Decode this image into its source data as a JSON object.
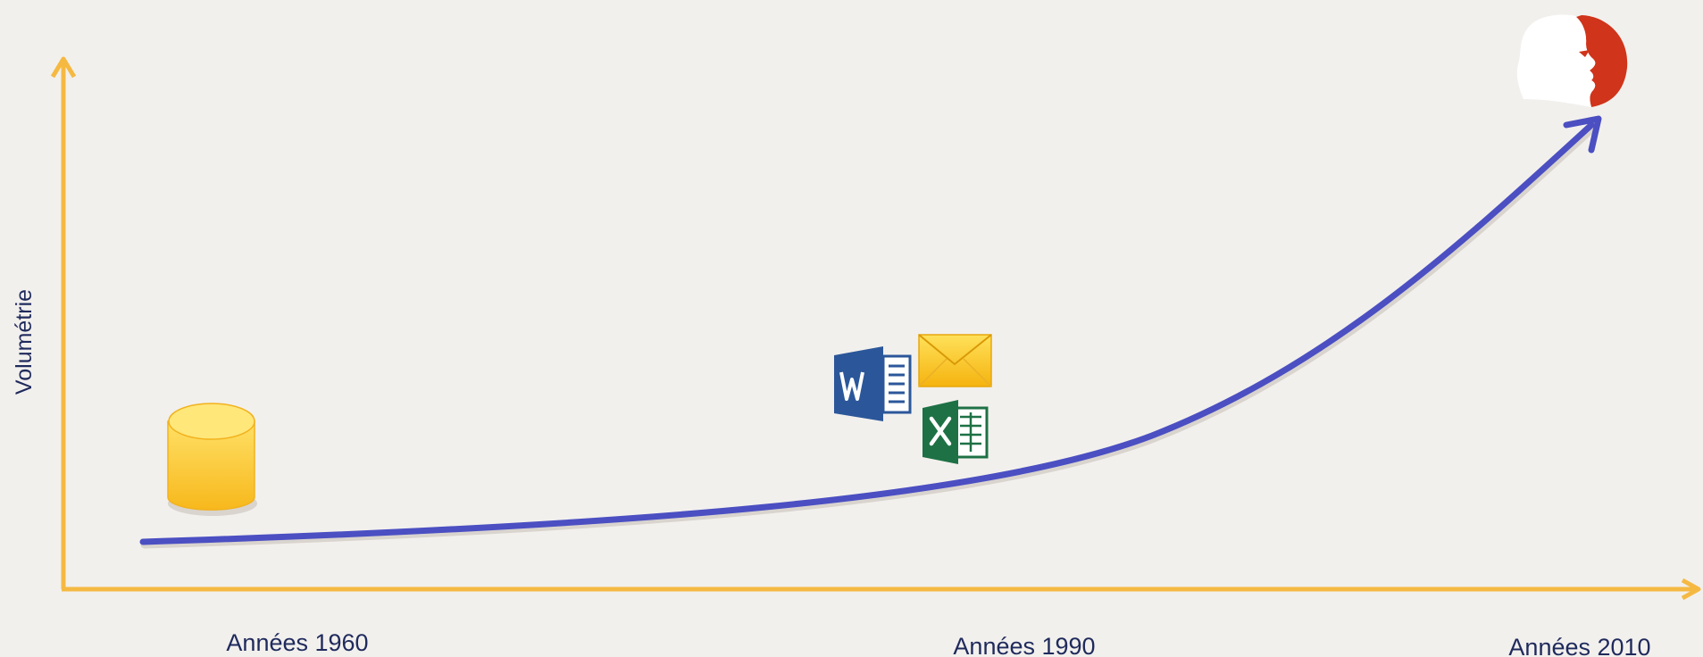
{
  "diagram": {
    "y_axis_label": "Volumétrie",
    "x_axis_labels": [
      "Années 1960",
      "Années 1990",
      "Années 2010"
    ],
    "colors": {
      "background": "#f2f0ed",
      "axis": "#f5b942",
      "curve": "#4b4fc2",
      "label_text": "#1f2a5c"
    },
    "icons": [
      {
        "name": "database-icon",
        "era": "Années 1960"
      },
      {
        "name": "word-document-icon",
        "era": "Années 1990"
      },
      {
        "name": "email-envelope-icon",
        "era": "Années 1990"
      },
      {
        "name": "excel-spreadsheet-icon",
        "era": "Années 1990"
      },
      {
        "name": "marianne-logo-icon",
        "era": "Années 2010"
      }
    ]
  }
}
